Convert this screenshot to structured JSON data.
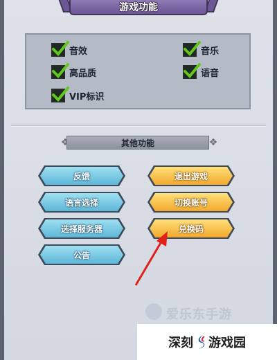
{
  "title": "游戏功能",
  "options": [
    {
      "label": "音效",
      "checked": true
    },
    {
      "label": "音乐",
      "checked": true
    },
    {
      "label": "高品质",
      "checked": true
    },
    {
      "label": "语音",
      "checked": true
    },
    {
      "label": "VIP标识",
      "checked": true
    }
  ],
  "section_title": "其他功能",
  "buttons": {
    "feedback": "反馈",
    "exit_game": "退出游戏",
    "language": "语言选择",
    "switch_account": "切换账号",
    "select_server": "选择服务器",
    "redeem_code": "兑换码",
    "notice": "公告"
  },
  "watermark": "爱乐东手游",
  "footer": {
    "left": "深刻",
    "right": "游戏园"
  },
  "colors": {
    "blue_button": "#5db6d8",
    "gold_button": "#f2a92c",
    "title_banner": "#6b5795",
    "arrow": "#e0211c",
    "check": "#63c81e"
  }
}
